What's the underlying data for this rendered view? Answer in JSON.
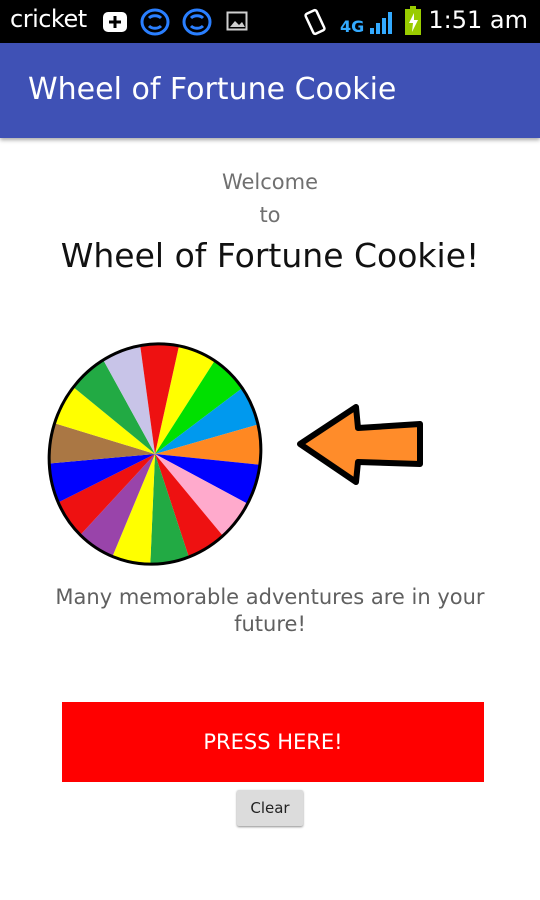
{
  "status_bar": {
    "carrier": "cricket",
    "network": "4G",
    "time": "1:51 am",
    "icons": [
      "plus-badge-icon",
      "sync-icon",
      "sync-icon",
      "image-icon",
      "vibrate-icon",
      "signal-icon",
      "battery-charging-icon"
    ]
  },
  "app_bar": {
    "title": "Wheel of Fortune Cookie",
    "color": "#3f51b5"
  },
  "content": {
    "welcome_line1": "Welcome",
    "welcome_line2": "to",
    "title": "Wheel of Fortune Cookie!",
    "wheel_colors": [
      "#ffff00",
      "#00e000",
      "#0099ee",
      "#ff8822",
      "#0000ff",
      "#ffaacc",
      "#ee1111",
      "#22aa44",
      "#ffff00",
      "#9944aa",
      "#ee1111",
      "#0000ff",
      "#aa7744",
      "#ffff00",
      "#22aa44",
      "#c8c4e8",
      "#ee1111"
    ],
    "arrow_color": "#ff8c2a",
    "fortune": "Many memorable adventures are in your future!"
  },
  "buttons": {
    "press": "PRESS HERE!",
    "press_color": "#ff0000",
    "clear": "Clear"
  }
}
